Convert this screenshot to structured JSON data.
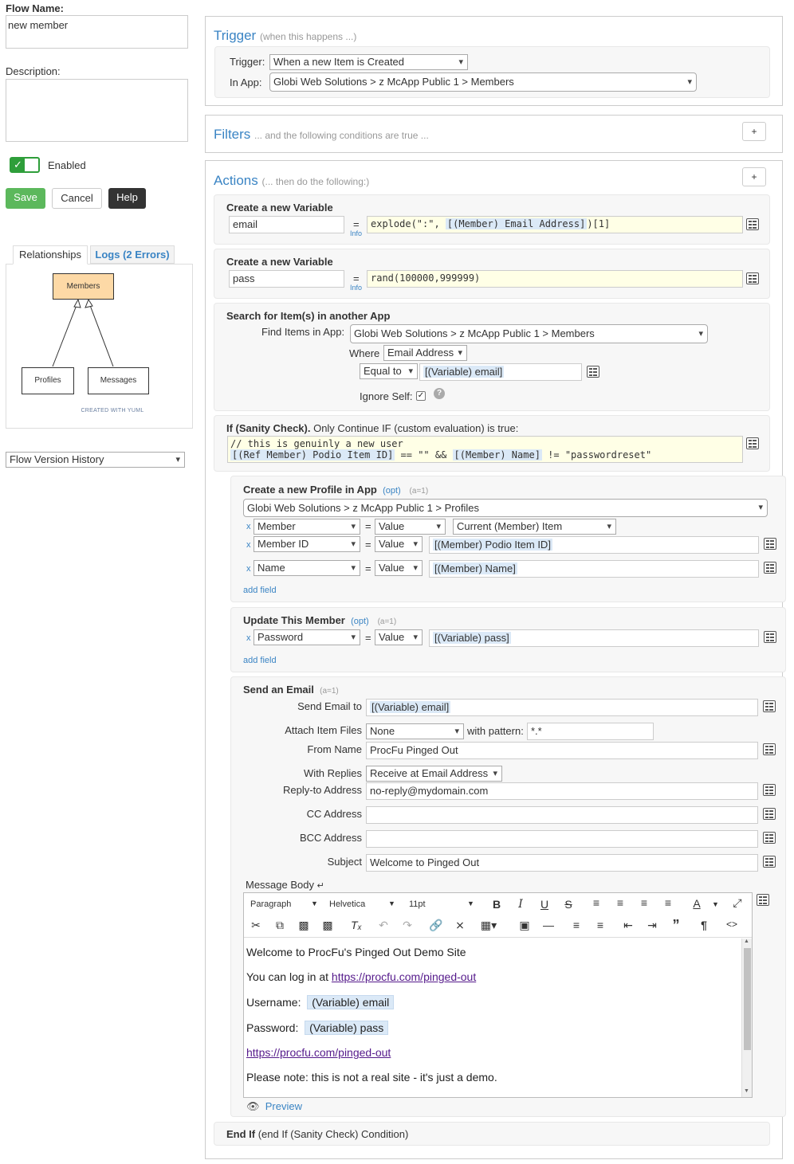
{
  "left": {
    "flow_name_label": "Flow Name:",
    "flow_name_value": "new member",
    "description_label": "Description:",
    "description_value": "",
    "enabled_label": "Enabled",
    "save_label": "Save",
    "cancel_label": "Cancel",
    "help_label": "Help",
    "tabs": [
      {
        "label": "Relationships"
      },
      {
        "label": "Logs (2 Errors)"
      }
    ],
    "diagram": {
      "members": "Members",
      "profiles": "Profiles",
      "messages": "Messages",
      "credit": "CREATED WITH YUML"
    },
    "version_history": "Flow Version History"
  },
  "trigger": {
    "title": "Trigger",
    "hint": "(when this happens ...)",
    "trigger_label": "Trigger:",
    "trigger_value": "When a new Item is Created",
    "app_label": "In App:",
    "app_value": "Globi Web Solutions > z McApp Public 1 > Members"
  },
  "filters": {
    "title": "Filters",
    "hint": "... and the following conditions are true ...",
    "plus": "+"
  },
  "actions": {
    "title": "Actions",
    "hint": "(... then do the following:)",
    "plus": "+",
    "var1": {
      "title": "Create a new Variable",
      "name": "email",
      "eq": "=",
      "info": "Info",
      "expr_pre": "explode(\":\", ",
      "expr_tok": "[(Member) Email Address]",
      "expr_post": ")[1]"
    },
    "var2": {
      "title": "Create a new Variable",
      "name": "pass",
      "eq": "=",
      "info": "Info",
      "expr": "rand(100000,999999)"
    },
    "search": {
      "title": "Search for Item(s) in another App",
      "find_label": "Find Items in App:",
      "find_value": "Globi Web Solutions > z McApp Public 1 > Members",
      "where_label": "Where",
      "where_value": "Email Address",
      "op_value": "Equal to",
      "match_value": "[(Variable) email]",
      "ignore_label": "Ignore Self:",
      "help_icon": "?"
    },
    "ifblock": {
      "title": "If (Sanity Check).",
      "desc": " Only Continue IF (custom evaluation) is true:",
      "code1": "// this is genuinly a new user",
      "code2_tok1": "[(Ref Member) Podio Item ID]",
      "code2_mid": " == \"\" && ",
      "code2_tok2": "[(Member) Name]",
      "code2_post": " != \"passwordreset\""
    },
    "profile": {
      "title": "Create a new Profile in App",
      "opt": "(opt)",
      "aeq": "(a=1)",
      "app_value": "Globi Web Solutions > z McApp Public 1 > Profiles",
      "rows": [
        {
          "x": "x",
          "field": "Member",
          "eq": "=",
          "type": "Value",
          "value": "Current (Member) Item"
        },
        {
          "x": "x",
          "field": "Member ID",
          "eq": "=",
          "type": "Value",
          "value": "[(Member) Podio Item ID]"
        },
        {
          "x": "x",
          "field": "Name",
          "eq": "=",
          "type": "Value",
          "value": "[(Member) Name]"
        }
      ],
      "add_field": "add field"
    },
    "update": {
      "title": "Update This Member",
      "opt": "(opt)",
      "aeq": "(a=1)",
      "row": {
        "x": "x",
        "field": "Password",
        "eq": "=",
        "type": "Value",
        "value": "[(Variable) pass]"
      },
      "add_field": "add field"
    },
    "email": {
      "title": "Send an Email",
      "aeq": "(a=1)",
      "to_label": "Send Email to",
      "to_value": "[(Variable) email]",
      "attach_label": "Attach Item Files",
      "attach_value": "None",
      "pattern_label": "with pattern:",
      "pattern_value": "*.*",
      "from_label": "From Name",
      "from_value": "ProcFu Pinged Out",
      "replies_label": "With Replies",
      "replies_value": "Receive at Email Address",
      "replyto_label": "Reply-to Address",
      "replyto_value": "no-reply@mydomain.com",
      "cc_label": "CC Address",
      "cc_value": "",
      "bcc_label": "BCC Address",
      "bcc_value": "",
      "subject_label": "Subject",
      "subject_value": "Welcome to Pinged Out",
      "body_label": "Message Body",
      "toolbar": {
        "format": "Paragraph",
        "font": "Helvetica",
        "size": "11pt"
      },
      "body": {
        "line1": "Welcome to ProcFu's Pinged Out Demo Site",
        "line2_pre": "You can log in at ",
        "line2_link": "https://procfu.com/pinged-out",
        "line3_pre": "Username:",
        "line3_tok": "(Variable) email",
        "line4_pre": "Password:",
        "line4_tok": "(Variable) pass",
        "line5_link": "https://procfu.com/pinged-out",
        "line6": "Please note: this is not a real site - it's just a demo."
      },
      "preview": "Preview"
    },
    "endif": {
      "title": "End If",
      "desc": " (end If (Sanity Check) Condition)"
    }
  },
  "colors": {
    "accent": "#3a84c4",
    "save": "#5cb85c",
    "help": "#333333",
    "toggle": "#2e9e3a"
  }
}
